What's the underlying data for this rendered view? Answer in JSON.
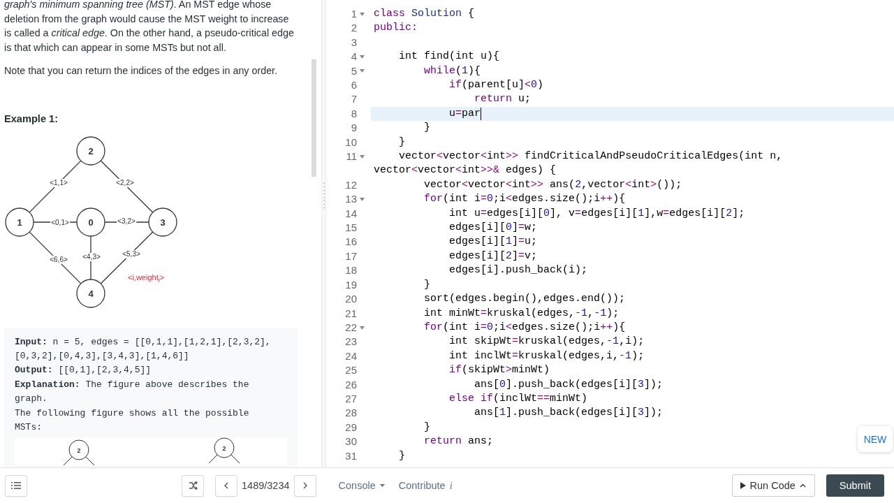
{
  "description": {
    "paragraphs": [
      "*graph's minimum spanning tree (MST)*. An MST edge whose deletion from the graph would cause the MST weight to increase is called a *critical edge*. On the other hand, a pseudo-critical edge is that which can appear in some MSTs but not all.",
      "Note that you can return the indices of the edges in any order."
    ],
    "example_heading": "Example 1:",
    "graph": {
      "nodes": [
        "2",
        "1",
        "0",
        "3",
        "4"
      ],
      "edge_labels": [
        "<1,1>",
        "<2,2>",
        "<0,1>",
        "<3,2>",
        "<6,6>",
        "<4,3>",
        "<5,3>"
      ],
      "legend": "<i,weight$_{i}$>"
    },
    "example_lines": [
      "**Input:** n = 5, edges = [[0,1,1],[1,2,1],[2,3,2],",
      "[0,3,2],[0,4,3],[3,4,3],[1,4,6]]",
      "**Output:** [[0,1],[2,3,4,5]]",
      "**Explanation:** The figure above describes the",
      "graph.",
      "The following figure shows all the possible",
      "MSTs:"
    ],
    "mst_figure": {
      "nodes": [
        "2",
        "2"
      ]
    }
  },
  "editor": {
    "lines": [
      {
        "n": "1",
        "fold": true,
        "active": false,
        "segs": [
          {
            "kind": "kw",
            "text": "class"
          },
          {
            "kind": "def",
            "text": " Solution"
          },
          {
            "kind": "tx",
            "text": " {"
          }
        ]
      },
      {
        "n": "2",
        "fold": false,
        "active": false,
        "segs": [
          {
            "kind": "kw",
            "text": "public:"
          }
        ]
      },
      {
        "n": "3",
        "fold": false,
        "active": false
      },
      {
        "n": "4",
        "fold": true,
        "active": false,
        "segs": [
          {
            "kind": "tx",
            "text": "    int find(int u){"
          }
        ]
      },
      {
        "n": "5",
        "fold": true,
        "active": false,
        "segs": [
          {
            "kind": "kw",
            "text": "        while"
          },
          {
            "kind": "tx",
            "text": "("
          },
          {
            "kind": "num",
            "text": "1"
          },
          {
            "kind": "tx",
            "text": "){"
          }
        ]
      },
      {
        "n": "6",
        "fold": false,
        "active": false,
        "segs": [
          {
            "kind": "kw",
            "text": "            if"
          },
          {
            "kind": "tx",
            "text": "(parent[u]"
          },
          {
            "kind": "op",
            "text": "<"
          },
          {
            "kind": "num",
            "text": "0"
          },
          {
            "kind": "tx",
            "text": ")"
          }
        ]
      },
      {
        "n": "7",
        "fold": false,
        "active": false,
        "segs": [
          {
            "kind": "kw",
            "text": "                return"
          },
          {
            "kind": "tx",
            "text": " u;"
          }
        ]
      },
      {
        "n": "8",
        "fold": false,
        "active": true,
        "segs": [
          {
            "kind": "tx",
            "text": "            u"
          },
          {
            "kind": "op",
            "text": "="
          },
          {
            "kind": "tx",
            "text": "par"
          }
        ]
      },
      {
        "n": "9",
        "fold": false,
        "active": false,
        "segs": [
          {
            "kind": "tx",
            "text": "        }"
          }
        ]
      },
      {
        "n": "10",
        "fold": false,
        "active": false,
        "segs": [
          {
            "kind": "tx",
            "text": "    }"
          }
        ]
      },
      {
        "n": "11",
        "fold": true,
        "active": false,
        "segs": [
          {
            "kind": "tx",
            "text": "    vector"
          },
          {
            "kind": "op",
            "text": "<"
          },
          {
            "kind": "tx",
            "text": "vector"
          },
          {
            "kind": "op",
            "text": "<"
          },
          {
            "kind": "tx",
            "text": "int"
          },
          {
            "kind": "op",
            "text": ">>"
          },
          {
            "kind": "tx",
            "text": " findCriticalAndPseudoCriticalEdges(int n, vector"
          },
          {
            "kind": "op",
            "text": "<"
          },
          {
            "kind": "tx",
            "text": "vector"
          },
          {
            "kind": "op",
            "text": "<"
          },
          {
            "kind": "tx",
            "text": "int"
          },
          {
            "kind": "op",
            "text": ">>&"
          },
          {
            "kind": "tx",
            "text": " edges) {"
          }
        ]
      },
      {
        "n": "12",
        "fold": false,
        "active": false,
        "segs": [
          {
            "kind": "tx",
            "text": "        vector"
          },
          {
            "kind": "op",
            "text": "<"
          },
          {
            "kind": "tx",
            "text": "vector"
          },
          {
            "kind": "op",
            "text": "<"
          },
          {
            "kind": "tx",
            "text": "int"
          },
          {
            "kind": "op",
            "text": ">>"
          },
          {
            "kind": "tx",
            "text": " ans("
          },
          {
            "kind": "num",
            "text": "2"
          },
          {
            "kind": "tx",
            "text": ",vector"
          },
          {
            "kind": "op",
            "text": "<"
          },
          {
            "kind": "tx",
            "text": "int"
          },
          {
            "kind": "op",
            "text": ">"
          },
          {
            "kind": "tx",
            "text": "());"
          }
        ]
      },
      {
        "n": "13",
        "fold": true,
        "active": false,
        "segs": [
          {
            "kind": "kw",
            "text": "        for"
          },
          {
            "kind": "tx",
            "text": "(int i"
          },
          {
            "kind": "op",
            "text": "="
          },
          {
            "kind": "num",
            "text": "0"
          },
          {
            "kind": "tx",
            "text": ";i"
          },
          {
            "kind": "op",
            "text": "<"
          },
          {
            "kind": "tx",
            "text": "edges.size();i"
          },
          {
            "kind": "op",
            "text": "++"
          },
          {
            "kind": "tx",
            "text": "){"
          }
        ]
      },
      {
        "n": "14",
        "fold": false,
        "active": false,
        "segs": [
          {
            "kind": "tx",
            "text": "            int u"
          },
          {
            "kind": "op",
            "text": "="
          },
          {
            "kind": "tx",
            "text": "edges[i]["
          },
          {
            "kind": "num",
            "text": "0"
          },
          {
            "kind": "tx",
            "text": "], v"
          },
          {
            "kind": "op",
            "text": "="
          },
          {
            "kind": "tx",
            "text": "edges[i]["
          },
          {
            "kind": "num",
            "text": "1"
          },
          {
            "kind": "tx",
            "text": "],w"
          },
          {
            "kind": "op",
            "text": "="
          },
          {
            "kind": "tx",
            "text": "edges[i]["
          },
          {
            "kind": "num",
            "text": "2"
          },
          {
            "kind": "tx",
            "text": "];"
          }
        ]
      },
      {
        "n": "15",
        "fold": false,
        "active": false,
        "segs": [
          {
            "kind": "tx",
            "text": "            edges[i]["
          },
          {
            "kind": "num",
            "text": "0"
          },
          {
            "kind": "tx",
            "text": "]"
          },
          {
            "kind": "op",
            "text": "="
          },
          {
            "kind": "tx",
            "text": "w;"
          }
        ]
      },
      {
        "n": "16",
        "fold": false,
        "active": false,
        "segs": [
          {
            "kind": "tx",
            "text": "            edges[i]["
          },
          {
            "kind": "num",
            "text": "1"
          },
          {
            "kind": "tx",
            "text": "]"
          },
          {
            "kind": "op",
            "text": "="
          },
          {
            "kind": "tx",
            "text": "u;"
          }
        ]
      },
      {
        "n": "17",
        "fold": false,
        "active": false,
        "segs": [
          {
            "kind": "tx",
            "text": "            edges[i]["
          },
          {
            "kind": "num",
            "text": "2"
          },
          {
            "kind": "tx",
            "text": "]"
          },
          {
            "kind": "op",
            "text": "="
          },
          {
            "kind": "tx",
            "text": "v;"
          }
        ]
      },
      {
        "n": "18",
        "fold": false,
        "active": false,
        "segs": [
          {
            "kind": "tx",
            "text": "            edges[i].push_back(i);"
          }
        ]
      },
      {
        "n": "19",
        "fold": false,
        "active": false,
        "segs": [
          {
            "kind": "tx",
            "text": "        }"
          }
        ]
      },
      {
        "n": "20",
        "fold": false,
        "active": false,
        "segs": [
          {
            "kind": "tx",
            "text": "        sort(edges.begin(),edges.end());"
          }
        ]
      },
      {
        "n": "21",
        "fold": false,
        "active": false,
        "segs": [
          {
            "kind": "tx",
            "text": "        int minWt"
          },
          {
            "kind": "op",
            "text": "="
          },
          {
            "kind": "tx",
            "text": "kruskal(edges,"
          },
          {
            "kind": "op",
            "text": "-"
          },
          {
            "kind": "num",
            "text": "1"
          },
          {
            "kind": "tx",
            "text": ","
          },
          {
            "kind": "op",
            "text": "-"
          },
          {
            "kind": "num",
            "text": "1"
          },
          {
            "kind": "tx",
            "text": ");"
          }
        ]
      },
      {
        "n": "22",
        "fold": true,
        "active": false,
        "segs": [
          {
            "kind": "kw",
            "text": "        for"
          },
          {
            "kind": "tx",
            "text": "(int i"
          },
          {
            "kind": "op",
            "text": "="
          },
          {
            "kind": "num",
            "text": "0"
          },
          {
            "kind": "tx",
            "text": ";i"
          },
          {
            "kind": "op",
            "text": "<"
          },
          {
            "kind": "tx",
            "text": "edges.size();i"
          },
          {
            "kind": "op",
            "text": "++"
          },
          {
            "kind": "tx",
            "text": "){"
          }
        ]
      },
      {
        "n": "23",
        "fold": false,
        "active": false,
        "segs": [
          {
            "kind": "tx",
            "text": "            int skipWt"
          },
          {
            "kind": "op",
            "text": "="
          },
          {
            "kind": "tx",
            "text": "kruskal(edges,"
          },
          {
            "kind": "op",
            "text": "-"
          },
          {
            "kind": "num",
            "text": "1"
          },
          {
            "kind": "tx",
            "text": ",i);"
          }
        ]
      },
      {
        "n": "24",
        "fold": false,
        "active": false,
        "segs": [
          {
            "kind": "tx",
            "text": "            int inclWt"
          },
          {
            "kind": "op",
            "text": "="
          },
          {
            "kind": "tx",
            "text": "kruskal(edges,i,"
          },
          {
            "kind": "op",
            "text": "-"
          },
          {
            "kind": "num",
            "text": "1"
          },
          {
            "kind": "tx",
            "text": ");"
          }
        ]
      },
      {
        "n": "25",
        "fold": false,
        "active": false,
        "segs": [
          {
            "kind": "kw",
            "text": "            if"
          },
          {
            "kind": "tx",
            "text": "(skipWt"
          },
          {
            "kind": "op",
            "text": ">"
          },
          {
            "kind": "tx",
            "text": "minWt)"
          }
        ]
      },
      {
        "n": "26",
        "fold": false,
        "active": false,
        "segs": [
          {
            "kind": "tx",
            "text": "                ans["
          },
          {
            "kind": "num",
            "text": "0"
          },
          {
            "kind": "tx",
            "text": "].push_back(edges[i]["
          },
          {
            "kind": "num",
            "text": "3"
          },
          {
            "kind": "tx",
            "text": "]);"
          }
        ]
      },
      {
        "n": "27",
        "fold": false,
        "active": false,
        "segs": [
          {
            "kind": "kw",
            "text": "            else if"
          },
          {
            "kind": "tx",
            "text": "(inclWt"
          },
          {
            "kind": "op",
            "text": "=="
          },
          {
            "kind": "tx",
            "text": "minWt)"
          }
        ]
      },
      {
        "n": "28",
        "fold": false,
        "active": false,
        "segs": [
          {
            "kind": "tx",
            "text": "                ans["
          },
          {
            "kind": "num",
            "text": "1"
          },
          {
            "kind": "tx",
            "text": "].push_back(edges[i]["
          },
          {
            "kind": "num",
            "text": "3"
          },
          {
            "kind": "tx",
            "text": "]);"
          }
        ]
      },
      {
        "n": "29",
        "fold": false,
        "active": false,
        "segs": [
          {
            "kind": "tx",
            "text": "        }"
          }
        ]
      },
      {
        "n": "30",
        "fold": false,
        "active": false,
        "segs": [
          {
            "kind": "kw",
            "text": "        return"
          },
          {
            "kind": "tx",
            "text": " ans;"
          }
        ]
      },
      {
        "n": "31",
        "fold": false,
        "active": false,
        "segs": [
          {
            "kind": "tx",
            "text": "    }"
          }
        ]
      }
    ],
    "new_badge": "NEW"
  },
  "bottom_bar": {
    "pager": "1489/3234",
    "console": "Console",
    "contribute": "Contribute",
    "contribute_mark": "i",
    "run_button": "Run Code",
    "submit_button": "Submit"
  }
}
